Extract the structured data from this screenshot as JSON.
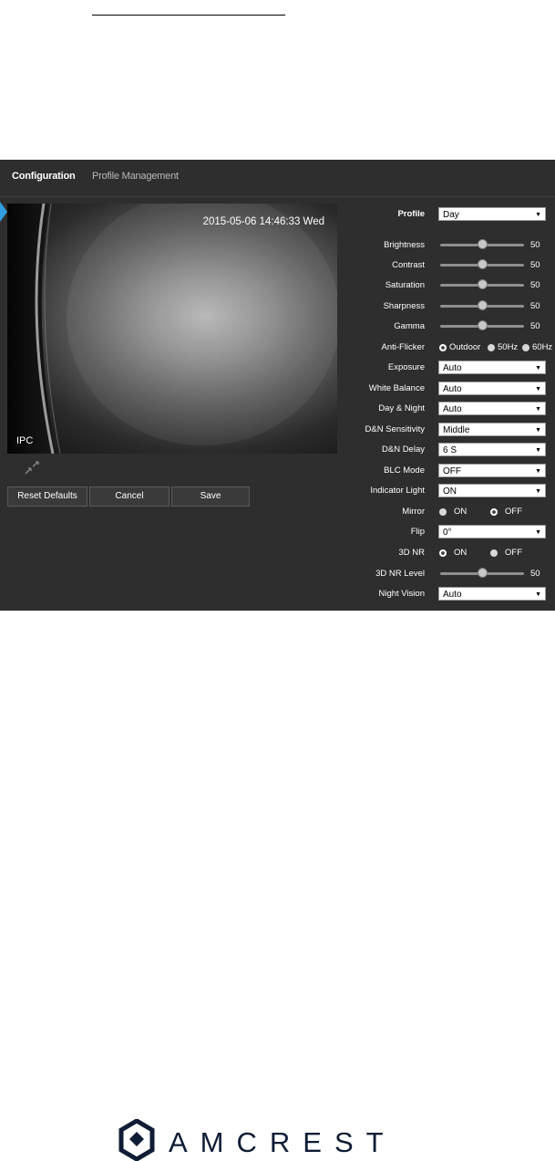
{
  "tabs": [
    {
      "label": "Configuration",
      "active": true
    },
    {
      "label": "Profile Management",
      "active": false
    }
  ],
  "video": {
    "timestamp": "2015-05-06 14:46:33 Wed",
    "channel_label": "IPC"
  },
  "buttons": {
    "reset_label": "Reset Defaults",
    "cancel_label": "Cancel",
    "save_label": "Save"
  },
  "settings": {
    "profile": {
      "label": "Profile",
      "value": "Day"
    },
    "brightness": {
      "label": "Brightness",
      "value": "50"
    },
    "contrast": {
      "label": "Contrast",
      "value": "50"
    },
    "saturation": {
      "label": "Saturation",
      "value": "50"
    },
    "sharpness": {
      "label": "Sharpness",
      "value": "50"
    },
    "gamma": {
      "label": "Gamma",
      "value": "50"
    },
    "anti_flicker": {
      "label": "Anti-Flicker",
      "options": [
        "Outdoor",
        "50Hz",
        "60Hz"
      ],
      "selected": "Outdoor"
    },
    "exposure": {
      "label": "Exposure",
      "value": "Auto"
    },
    "white_balance": {
      "label": "White Balance",
      "value": "Auto"
    },
    "day_night": {
      "label": "Day & Night",
      "value": "Auto"
    },
    "dn_sensitivity": {
      "label": "D&N Sensitivity",
      "value": "Middle"
    },
    "dn_delay": {
      "label": "D&N Delay",
      "value": "6 S"
    },
    "blc_mode": {
      "label": "BLC Mode",
      "value": "OFF"
    },
    "indicator_light": {
      "label": "Indicator Light",
      "value": "ON"
    },
    "mirror": {
      "label": "Mirror",
      "options": [
        "ON",
        "OFF"
      ],
      "selected": "OFF"
    },
    "flip": {
      "label": "Flip",
      "value": "0°"
    },
    "nr_3d": {
      "label": "3D NR",
      "options": [
        "ON",
        "OFF"
      ],
      "selected": "ON"
    },
    "nr_3d_level": {
      "label": "3D NR Level",
      "value": "50"
    },
    "night_vision": {
      "label": "Night Vision",
      "value": "Auto"
    }
  },
  "slider_max": 100,
  "brand": {
    "name": "AMCREST",
    "color": "#0e1d35"
  },
  "colors": {
    "panel_bg": "#2e2e2e",
    "accent": "#2f9fe0"
  }
}
